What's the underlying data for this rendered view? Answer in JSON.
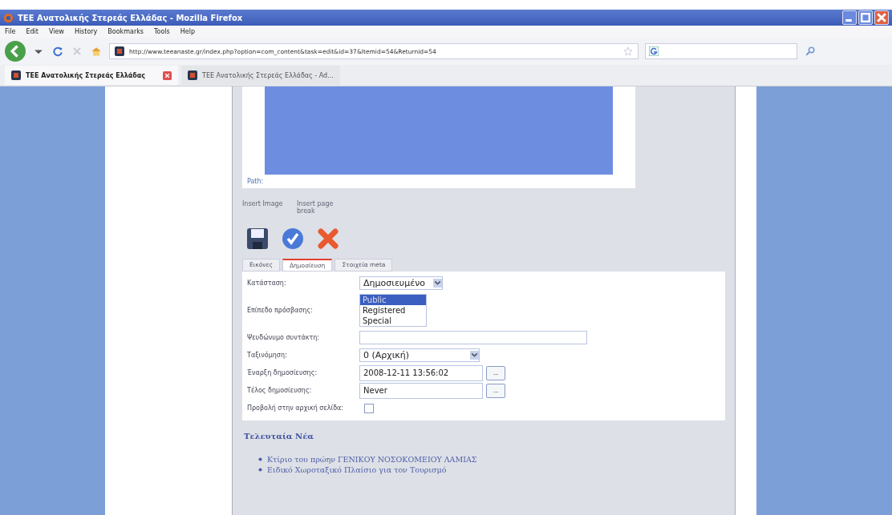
{
  "window": {
    "title": "ΤΕΕ Ανατολικής Στερεάς Ελλάδας - Mozilla Firefox"
  },
  "menu": [
    "File",
    "Edit",
    "View",
    "History",
    "Bookmarks",
    "Tools",
    "Help"
  ],
  "address": {
    "value": "http://www.teeanaste.gr/index.php?option=com_content&task=edit&id=37&Itemid=54&Returnid=54"
  },
  "browser_tabs": [
    {
      "label": "ΤΕΕ Ανατολικής Στερεάς Ελλάδας",
      "selected": true
    },
    {
      "label": "ΤΕΕ Ανατολικής Στερεάς Ελλάδας - Ad...",
      "selected": false
    }
  ],
  "editor": {
    "path_label": "Path:",
    "buttons": [
      "Insert Image",
      "Insert page break"
    ]
  },
  "form_tabs": [
    {
      "label": "Εικόνες",
      "selected": false
    },
    {
      "label": "Δημοσίευση",
      "selected": true
    },
    {
      "label": "Στοιχεία meta",
      "selected": false
    }
  ],
  "fields": [
    {
      "kind": "select",
      "label": "Κατάσταση:",
      "value": "Δημοσιευμένο"
    },
    {
      "kind": "listbox",
      "label": "Επίπεδο πρόσβασης:",
      "options": [
        {
          "label": "Public",
          "selected": true
        },
        {
          "label": "Registered",
          "selected": false
        },
        {
          "label": "Special",
          "selected": false
        }
      ]
    },
    {
      "kind": "text",
      "label": "Ψευδώνυμο συντάκτη:"
    },
    {
      "kind": "select",
      "label": "Ταξινόμηση:",
      "value": "0 (Αρχική)"
    },
    {
      "kind": "date",
      "label": "Έναρξη δημοσίευσης:",
      "value": "2008-12-11 13:56:02",
      "button": "..."
    },
    {
      "kind": "date",
      "label": "Τέλος δημοσίευσης:",
      "value": "Never",
      "button": "..."
    },
    {
      "kind": "checkbox",
      "label": "Προβολή στην αρχική σελίδα:",
      "checked": false
    }
  ],
  "news": {
    "title": "Τελευταία Νέα",
    "items": [
      "Κτίριο του πρώην ΓΕΝΙΚΟΥ ΝΟΣΟΚΟΜΕΙΟΥ ΛΑΜΙΑΣ",
      "Ειδικό Χωροταξικό Πλαίσιο για τον Τουρισμό"
    ]
  }
}
